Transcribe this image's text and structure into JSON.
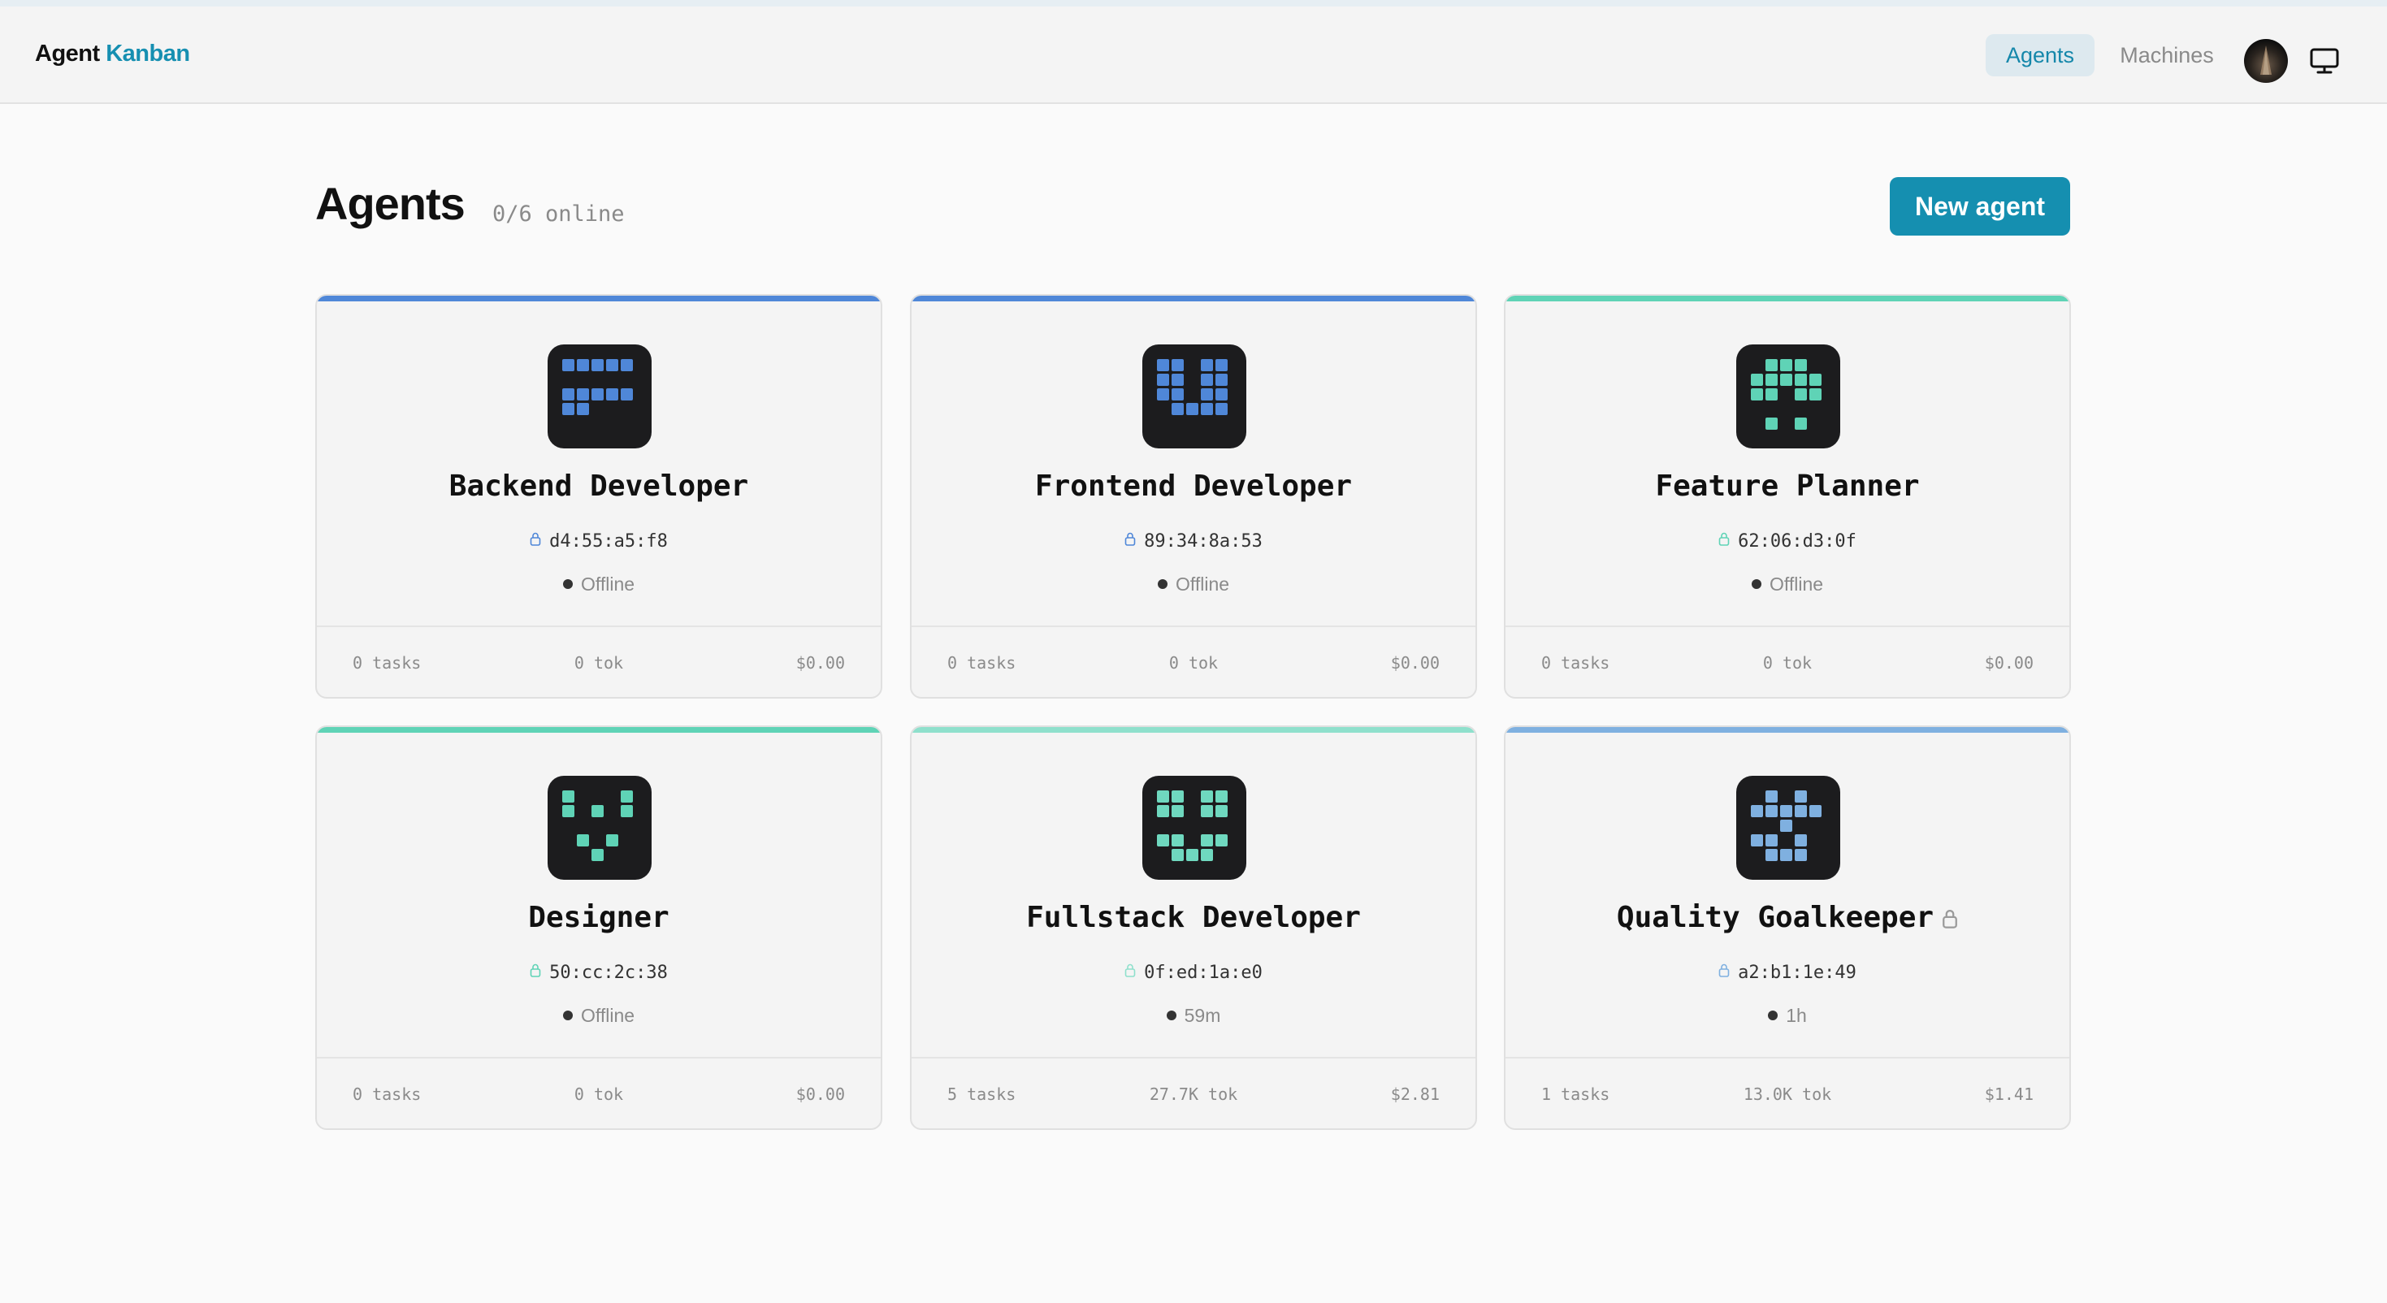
{
  "header": {
    "brand_part1": "Agent",
    "brand_part2": "Kanban",
    "nav": {
      "agents": "Agents",
      "machines": "Machines"
    }
  },
  "page": {
    "title": "Agents",
    "online": "0/6 online",
    "new_agent_label": "New agent"
  },
  "colors": {
    "brand_accent": "#168fb1",
    "button": "#158fb0",
    "blue": "#4f87d8",
    "teal": "#5fd3b6",
    "light_blue": "#7fb0e0"
  },
  "agents": [
    {
      "name": "Backend Developer",
      "mac": "d4:55:a5:f8",
      "status": "Offline",
      "tasks": "0 tasks",
      "tok": "0 tok",
      "cost": "$0.00",
      "accent": "#4f87d8",
      "icon_color": "#4f87d8",
      "locked": false
    },
    {
      "name": "Frontend Developer",
      "mac": "89:34:8a:53",
      "status": "Offline",
      "tasks": "0 tasks",
      "tok": "0 tok",
      "cost": "$0.00",
      "accent": "#4f87d8",
      "icon_color": "#4f87d8",
      "locked": false
    },
    {
      "name": "Feature Planner",
      "mac": "62:06:d3:0f",
      "status": "Offline",
      "tasks": "0 tasks",
      "tok": "0 tok",
      "cost": "$0.00",
      "accent": "#5fd3b6",
      "icon_color": "#5fd3b6",
      "locked": false
    },
    {
      "name": "Designer",
      "mac": "50:cc:2c:38",
      "status": "Offline",
      "tasks": "0 tasks",
      "tok": "0 tok",
      "cost": "$0.00",
      "accent": "#5fd3b6",
      "icon_color": "#5fd3b6",
      "locked": false
    },
    {
      "name": "Fullstack Developer",
      "mac": "0f:ed:1a:e0",
      "status": "59m",
      "tasks": "5 tasks",
      "tok": "27.7K tok",
      "cost": "$2.81",
      "accent": "#8fe0cc",
      "icon_color": "#6fd8bf",
      "locked": false
    },
    {
      "name": "Quality Goalkeeper",
      "mac": "a2:b1:1e:49",
      "status": "1h",
      "tasks": "1 tasks",
      "tok": "13.0K tok",
      "cost": "$1.41",
      "accent": "#7fb0e0",
      "icon_color": "#7fb0e0",
      "locked": true
    }
  ]
}
